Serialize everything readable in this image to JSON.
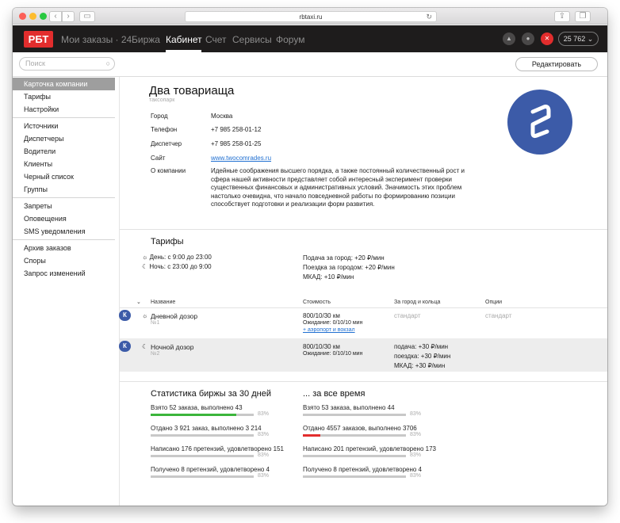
{
  "browser": {
    "url": "rbtaxi.ru"
  },
  "header": {
    "logo": "РБТ",
    "nav": [
      {
        "label": "Мои заказы · 24",
        "active": false
      },
      {
        "label": "Биржа",
        "active": false
      },
      {
        "label": "Кабинет",
        "active": true
      },
      {
        "label": "Счет",
        "active": false
      },
      {
        "label": "Сервисы",
        "active": false
      },
      {
        "label": "Форум",
        "active": false
      }
    ],
    "balance": "25 762 ⌄",
    "accent": "#e22d2d"
  },
  "search": {
    "placeholder": "Поиск"
  },
  "edit_label": "Редактировать",
  "sidebar": {
    "groups": [
      [
        "Карточка компании",
        "Тарифы",
        "Настройки"
      ],
      [
        "Источники",
        "Диспетчеры",
        "Водители",
        "Клиенты",
        "Черный список",
        "Группы"
      ],
      [
        "Запреты",
        "Оповещения",
        "SMS уведомления"
      ],
      [
        "Архив заказов",
        "Споры",
        "Запрос изменений"
      ]
    ],
    "active": "Карточка компании"
  },
  "company": {
    "name": "Два товариаща",
    "type": "таксопарк",
    "fields": [
      {
        "label": "Город",
        "value": "Москва"
      },
      {
        "label": "Телефон",
        "value": "+7 985 258-01-12"
      },
      {
        "label": "Диспетчер",
        "value": "+7 985 258-01-25"
      },
      {
        "label": "Сайт",
        "value": "www.twocomrades.ru"
      }
    ],
    "about_label": "О компании",
    "about": "Идейные соображения высшего порядка, а также постоянный количественный рост и сфера нашей активности представляет собой интересный эксперимент проверки существенных финансовых и административных условий. Значимость этих проблем настолько очевидна, что начало повседневной работы по формированию позиции способствует подготовки и реализации форм развития.",
    "brand_color": "#3c5ba8"
  },
  "tariffs": {
    "title": "Тарифы",
    "day": "День: с 9:00 до 23:00",
    "night": "Ночь: с 23:00 до 9:00",
    "city": "Подача за город: +20 ₽/мин",
    "outside": "Поездка за городом: +20 ₽/мин",
    "mkad": "МКАД: +10 ₽/мин",
    "columns": [
      "Название",
      "Стоимость",
      "За город и кольца",
      "Опции"
    ],
    "rows": [
      {
        "badge": "К",
        "name": "Дневной дозор",
        "num": "№1",
        "cost": "800/10/30 км",
        "wait": "Ожидание: 0/10/10 мин",
        "extra_link": "+ аэропорт и вокзал",
        "outside": "стандарт",
        "options": "стандарт"
      },
      {
        "badge": "К",
        "name": "Ночной дозор",
        "num": "№2",
        "cost": "800/10/30 км",
        "wait": "Ожидание: 0/10/10 мин",
        "outside_lines": [
          "подача: +30 ₽/мин",
          "поездка: +30 ₽/мин",
          "МКАД: +30 ₽/мин"
        ]
      }
    ]
  },
  "stats": {
    "left_title": "Статистика биржы за 30 дней",
    "right_title": "... за все время",
    "left": [
      {
        "text": "Взято 52 заказа, выполнено 43",
        "pct": "83%",
        "fill": 0.83,
        "color": "#3bb53b"
      },
      {
        "text": "Отдано 3 921 заказ, выполнено 3 214",
        "pct": "83%",
        "fill": 0.0,
        "color": "#e22d2d"
      },
      {
        "text": "Написано 176 претензий, удовлетворено 151",
        "pct": "83%",
        "fill": 0.0,
        "color": "#999999"
      },
      {
        "text": "Получено 8 претензий, удовлетворено 4",
        "pct": "83%",
        "fill": 0.0,
        "color": "#999999"
      }
    ],
    "right": [
      {
        "text": "Взято 53 заказа, выполнено 44",
        "pct": "83%",
        "fill": 0.0,
        "color": "#3bb53b"
      },
      {
        "text": "Отдано 4557 заказов, выполнено 3706",
        "pct": "83%",
        "fill": 0.17,
        "color": "#e22d2d"
      },
      {
        "text": "Написано 201 претензий, удовлетворено 173",
        "pct": "83%",
        "fill": 0.0,
        "color": "#999999"
      },
      {
        "text": "Получено 8 претензий, удовлетворено 4",
        "pct": "83%",
        "fill": 0.0,
        "color": "#999999"
      }
    ]
  }
}
